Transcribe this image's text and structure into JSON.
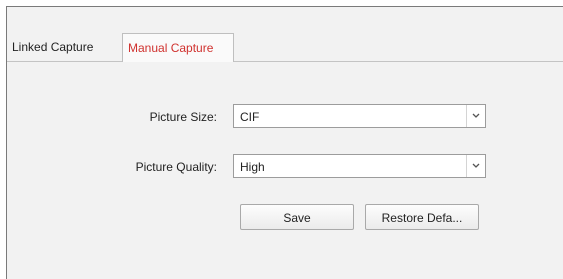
{
  "tabs": {
    "linked_capture": "Linked Capture",
    "manual_capture": "Manual Capture",
    "active": "manual_capture",
    "active_color": "#d0322f"
  },
  "form": {
    "picture_size": {
      "label": "Picture Size:",
      "value": "CIF"
    },
    "picture_quality": {
      "label": "Picture Quality:",
      "value": "High"
    }
  },
  "buttons": {
    "save": "Save",
    "restore": "Restore Defa..."
  }
}
